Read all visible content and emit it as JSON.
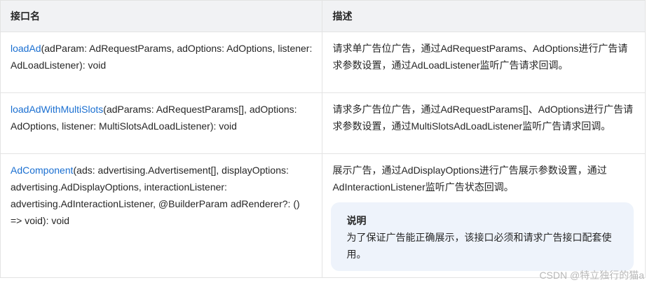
{
  "table": {
    "headers": {
      "name": "接口名",
      "desc": "描述"
    },
    "rows": [
      {
        "link": "loadAd",
        "signature": "(adParam: AdRequestParams, adOptions: AdOptions, listener: AdLoadListener): void",
        "desc": "请求单广告位广告，通过AdRequestParams、AdOptions进行广告请求参数设置，通过AdLoadListener监听广告请求回调。"
      },
      {
        "link": "loadAdWithMultiSlots",
        "signature": "(adParams: AdRequestParams[], adOptions: AdOptions, listener: MultiSlotsAdLoadListener): void",
        "desc": "请求多广告位广告，通过AdRequestParams[]、AdOptions进行广告请求参数设置，通过MultiSlotsAdLoadListener监听广告请求回调。"
      },
      {
        "link": "AdComponent",
        "signature": "(ads: advertising.Advertisement[], displayOptions: advertising.AdDisplayOptions, interactionListener: advertising.AdInteractionListener, @BuilderParam adRenderer?: () => void): void",
        "desc": "展示广告，通过AdDisplayOptions进行广告展示参数设置，通过AdInteractionListener监听广告状态回调。",
        "note": {
          "title": "说明",
          "text": "为了保证广告能正确展示，该接口必须和请求广告接口配套使用。"
        }
      }
    ]
  },
  "watermark": "CSDN @特立独行的猫a"
}
